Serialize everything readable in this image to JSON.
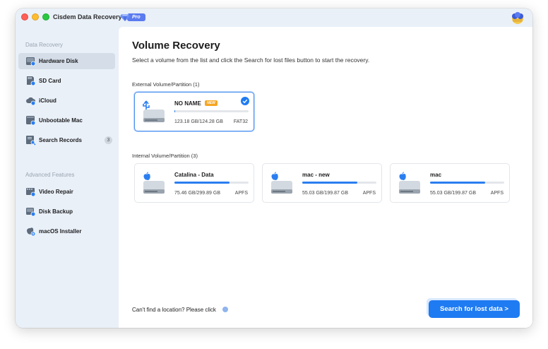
{
  "app": {
    "title": "Cisdem Data Recovery",
    "badge": "Pro"
  },
  "sidebar": {
    "section1": "Data Recovery",
    "section2": "Advanced Features",
    "items": [
      {
        "label": "Hardware Disk",
        "icon": "hardware-disk-icon",
        "active": true
      },
      {
        "label": "SD Card",
        "icon": "sd-card-icon"
      },
      {
        "label": "iCloud",
        "icon": "icloud-icon"
      },
      {
        "label": "Unbootable Mac",
        "icon": "unbootable-mac-icon"
      },
      {
        "label": "Search Records",
        "icon": "search-records-icon",
        "count": "3"
      }
    ],
    "advanced": [
      {
        "label": "Video Repair",
        "icon": "video-repair-icon"
      },
      {
        "label": "Disk Backup",
        "icon": "disk-backup-icon"
      },
      {
        "label": "macOS Installer",
        "icon": "macos-installer-icon"
      }
    ]
  },
  "main": {
    "title": "Volume Recovery",
    "subtitle": "Select a volume from the list and click the Search for lost files button to start the recovery.",
    "external_label": "External Volume/Partition (1)",
    "internal_label": "Internal Volume/Partition (3)",
    "external": [
      {
        "name": "NO NAME",
        "tag": "NEW",
        "size": "123.18 GB/124.28 GB",
        "fs": "FAT32",
        "usage": 0.01,
        "selected": true
      }
    ],
    "internal": [
      {
        "name": "Catalina - Data",
        "size": "75.46 GB/299.89 GB",
        "fs": "APFS",
        "usage": 0.74
      },
      {
        "name": "mac - new",
        "size": "55.03 GB/199.87 GB",
        "fs": "APFS",
        "usage": 0.74
      },
      {
        "name": "mac",
        "size": "55.03 GB/199.87 GB",
        "fs": "APFS",
        "usage": 0.74
      }
    ],
    "help_text": "Can't find a location? Please click",
    "search_button": "Search for lost data >"
  },
  "colors": {
    "accent": "#1f7bf2",
    "new_tag": "#f5a623",
    "sidebar_bg": "#e9f0f8"
  }
}
